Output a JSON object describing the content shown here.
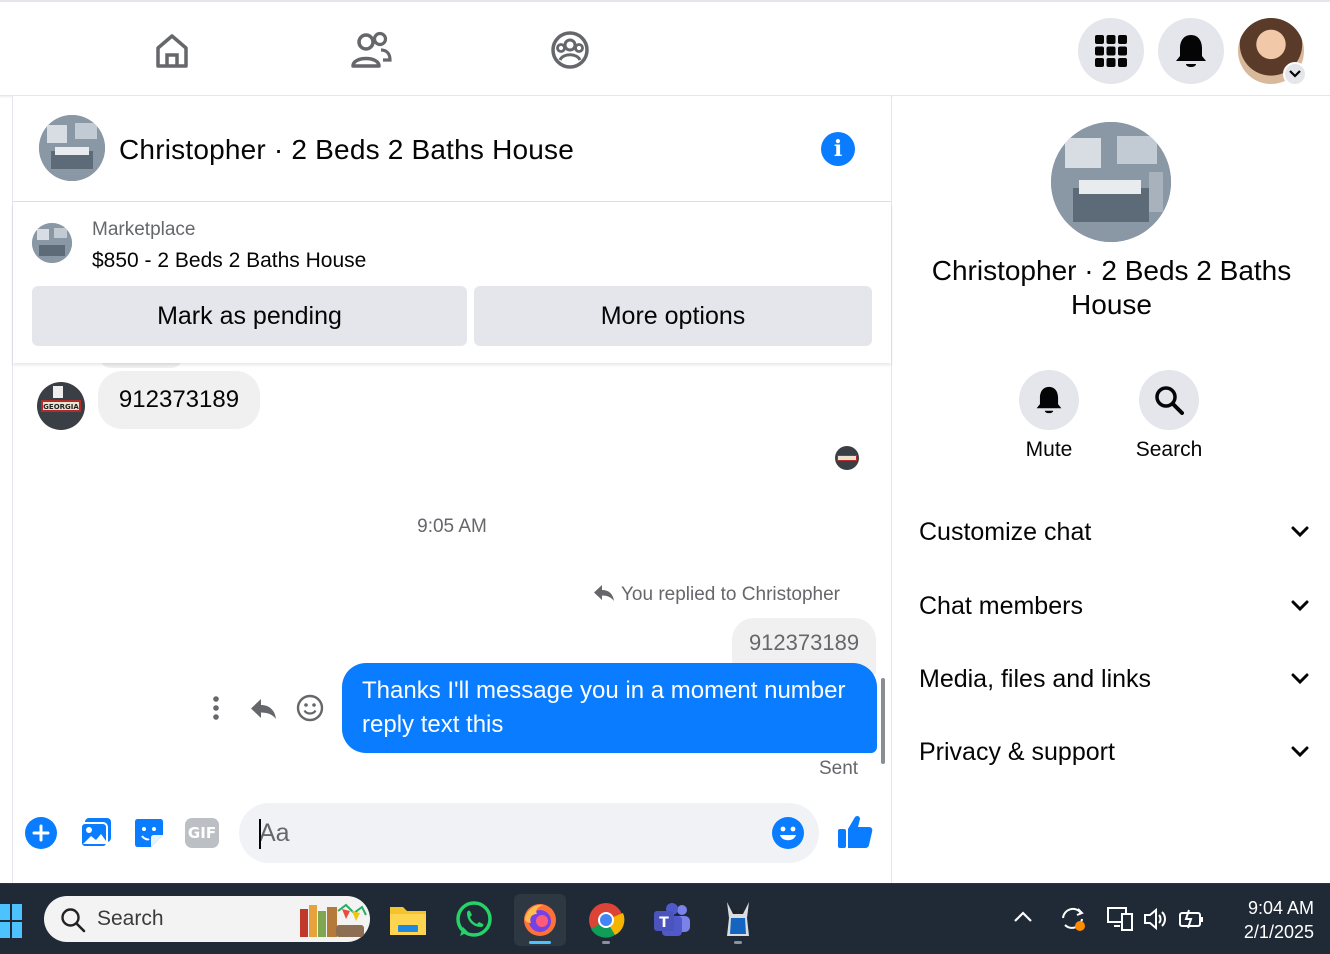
{
  "topnav": {
    "icons": [
      "home-icon",
      "friends-icon",
      "groups-icon"
    ],
    "right_buttons": [
      "menu-grid-icon",
      "notifications-bell-icon",
      "account-avatar"
    ]
  },
  "chat": {
    "title": "Christopher · 2 Beds 2 Baths House",
    "marketplace": {
      "label": "Marketplace",
      "item": "$850 - 2 Beds 2 Baths House",
      "mark_pending": "Mark as pending",
      "more_options": "More options"
    },
    "messages": {
      "incoming_text": "912373189",
      "timestamp": "9:05 AM",
      "reply_note": "You replied to Christopher",
      "quoted_text": "912373189",
      "outgoing_text": "Thanks I'll message you in a moment number reply text this",
      "status": "Sent"
    },
    "composer": {
      "placeholder": "Aa"
    },
    "accent_color": "#0a7cff"
  },
  "details": {
    "name": "Christopher · 2 Beds 2 Baths House",
    "mute_label": "Mute",
    "search_label": "Search",
    "sections": [
      "Customize chat",
      "Chat members",
      "Media, files and links",
      "Privacy & support"
    ]
  },
  "taskbar": {
    "search_label": "Search",
    "time": "9:04 AM",
    "date": "2/1/2025",
    "apps": [
      "file-explorer-icon",
      "whatsapp-icon",
      "firefox-icon",
      "chrome-icon",
      "teams-icon",
      "app-icon"
    ]
  }
}
